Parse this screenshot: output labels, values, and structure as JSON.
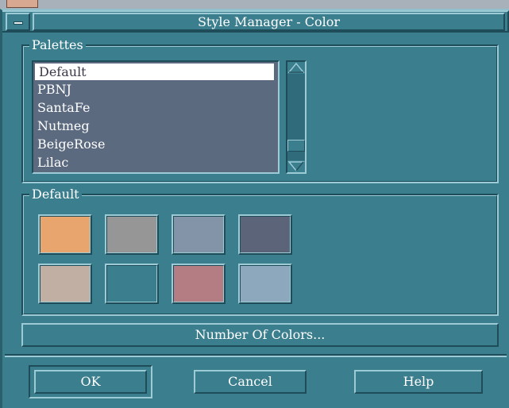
{
  "window": {
    "title": "Style Manager - Color"
  },
  "palettes": {
    "label": "Palettes",
    "items": [
      "Default",
      "PBNJ",
      "SantaFe",
      "Nutmeg",
      "BeigeRose",
      "Lilac"
    ],
    "selected_index": 0
  },
  "palette_colors": {
    "label": "Default",
    "swatches": [
      "#e9a56e",
      "#969696",
      "#8393a8",
      "#5c6479",
      "#c2afa4",
      "#3b7e8e",
      "#b47d84",
      "#8da7bd"
    ]
  },
  "number_of_colors_button": "Number Of Colors...",
  "actions": {
    "ok_label": "OK",
    "cancel_label": "Cancel",
    "help_label": "Help"
  }
}
